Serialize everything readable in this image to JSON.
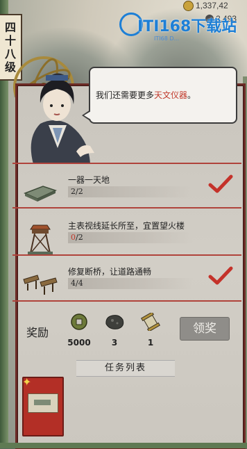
{
  "header": {
    "gold_value": "1,337,42",
    "resource_value": "2,493",
    "level_chars": [
      "四",
      "十",
      "八",
      "级"
    ]
  },
  "watermark": {
    "brand": "ITI168下载站",
    "sub": "ITI68 D..."
  },
  "dialog": {
    "text_prefix": "我们还需要更多",
    "highlight": "天文仪器",
    "text_suffix": "。"
  },
  "tasks": [
    {
      "title": "一器一天地",
      "current": "2",
      "total": "/2",
      "completed": true,
      "icon": "wall-structure-icon"
    },
    {
      "title": "主表视线延长所至，宜置望火楼",
      "current": "0",
      "total": "/2",
      "completed": false,
      "icon": "watchtower-icon"
    },
    {
      "title": "修复断桥，让道路通畅",
      "current": "4",
      "total": "/4",
      "completed": true,
      "icon": "broken-bridge-icon"
    }
  ],
  "rewards": {
    "label": "奖励",
    "items": [
      {
        "icon": "copper-coin-icon",
        "value": "5000"
      },
      {
        "icon": "ore-stone-icon",
        "value": "3"
      },
      {
        "icon": "scroll-icon",
        "value": "1"
      }
    ],
    "claim_label": "领奖"
  },
  "task_list": {
    "header": "任务列表"
  },
  "colors": {
    "accent_red": "#c0392b",
    "panel_border": "#6b2a25"
  }
}
